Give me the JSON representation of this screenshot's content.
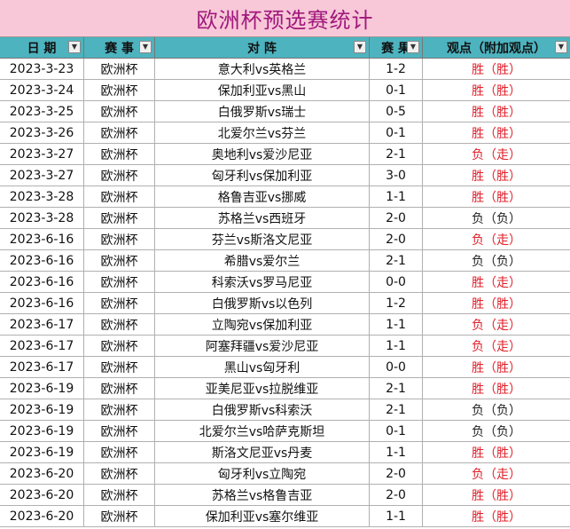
{
  "title": "欧洲杯预选赛统计",
  "headers": {
    "date": "日 期",
    "event": "赛 事",
    "match": "对 阵",
    "score": "赛 果",
    "view": "观点（附加观点）"
  },
  "colors": {
    "title_bg": "#f8c8d8",
    "title_text": "#a0187c",
    "header_bg": "#4db3bf",
    "win_text": "#e0202a",
    "loss_text": "#222222"
  },
  "rows": [
    {
      "date": "2023-3-23",
      "event": "欧洲杯",
      "match": "意大利vs英格兰",
      "score": "1-2",
      "view": "胜（胜）",
      "tone": "red"
    },
    {
      "date": "2023-3-24",
      "event": "欧洲杯",
      "match": "保加利亚vs黑山",
      "score": "0-1",
      "view": "胜（胜）",
      "tone": "red"
    },
    {
      "date": "2023-3-25",
      "event": "欧洲杯",
      "match": "白俄罗斯vs瑞士",
      "score": "0-5",
      "view": "胜（胜）",
      "tone": "red"
    },
    {
      "date": "2023-3-26",
      "event": "欧洲杯",
      "match": "北爱尔兰vs芬兰",
      "score": "0-1",
      "view": "胜（胜）",
      "tone": "red"
    },
    {
      "date": "2023-3-27",
      "event": "欧洲杯",
      "match": "奥地利vs爱沙尼亚",
      "score": "2-1",
      "view": "负（走）",
      "tone": "red"
    },
    {
      "date": "2023-3-27",
      "event": "欧洲杯",
      "match": "匈牙利vs保加利亚",
      "score": "3-0",
      "view": "胜（胜）",
      "tone": "red"
    },
    {
      "date": "2023-3-28",
      "event": "欧洲杯",
      "match": "格鲁吉亚vs挪威",
      "score": "1-1",
      "view": "胜（胜）",
      "tone": "red"
    },
    {
      "date": "2023-3-28",
      "event": "欧洲杯",
      "match": "苏格兰vs西班牙",
      "score": "2-0",
      "view": "负（负）",
      "tone": "dark"
    },
    {
      "date": "2023-6-16",
      "event": "欧洲杯",
      "match": "芬兰vs斯洛文尼亚",
      "score": "2-0",
      "view": "负（走）",
      "tone": "red"
    },
    {
      "date": "2023-6-16",
      "event": "欧洲杯",
      "match": "希腊vs爱尔兰",
      "score": "2-1",
      "view": "负（负）",
      "tone": "dark"
    },
    {
      "date": "2023-6-16",
      "event": "欧洲杯",
      "match": "科索沃vs罗马尼亚",
      "score": "0-0",
      "view": "胜（走）",
      "tone": "red"
    },
    {
      "date": "2023-6-16",
      "event": "欧洲杯",
      "match": "白俄罗斯vs以色列",
      "score": "1-2",
      "view": "胜（胜）",
      "tone": "red"
    },
    {
      "date": "2023-6-17",
      "event": "欧洲杯",
      "match": "立陶宛vs保加利亚",
      "score": "1-1",
      "view": "负（走）",
      "tone": "red"
    },
    {
      "date": "2023-6-17",
      "event": "欧洲杯",
      "match": "阿塞拜疆vs爱沙尼亚",
      "score": "1-1",
      "view": "负（走）",
      "tone": "red"
    },
    {
      "date": "2023-6-17",
      "event": "欧洲杯",
      "match": "黑山vs匈牙利",
      "score": "0-0",
      "view": "胜（胜）",
      "tone": "red"
    },
    {
      "date": "2023-6-19",
      "event": "欧洲杯",
      "match": "亚美尼亚vs拉脱维亚",
      "score": "2-1",
      "view": "胜（胜）",
      "tone": "red"
    },
    {
      "date": "2023-6-19",
      "event": "欧洲杯",
      "match": "白俄罗斯vs科索沃",
      "score": "2-1",
      "view": "负（负）",
      "tone": "dark"
    },
    {
      "date": "2023-6-19",
      "event": "欧洲杯",
      "match": "北爱尔兰vs哈萨克斯坦",
      "score": "0-1",
      "view": "负（负）",
      "tone": "dark"
    },
    {
      "date": "2023-6-19",
      "event": "欧洲杯",
      "match": "斯洛文尼亚vs丹麦",
      "score": "1-1",
      "view": "胜（胜）",
      "tone": "red"
    },
    {
      "date": "2023-6-20",
      "event": "欧洲杯",
      "match": "匈牙利vs立陶宛",
      "score": "2-0",
      "view": "负（走）",
      "tone": "red"
    },
    {
      "date": "2023-6-20",
      "event": "欧洲杯",
      "match": "苏格兰vs格鲁吉亚",
      "score": "2-0",
      "view": "胜（胜）",
      "tone": "red"
    },
    {
      "date": "2023-6-20",
      "event": "欧洲杯",
      "match": "保加利亚vs塞尔维亚",
      "score": "1-1",
      "view": "胜（胜）",
      "tone": "red"
    }
  ]
}
